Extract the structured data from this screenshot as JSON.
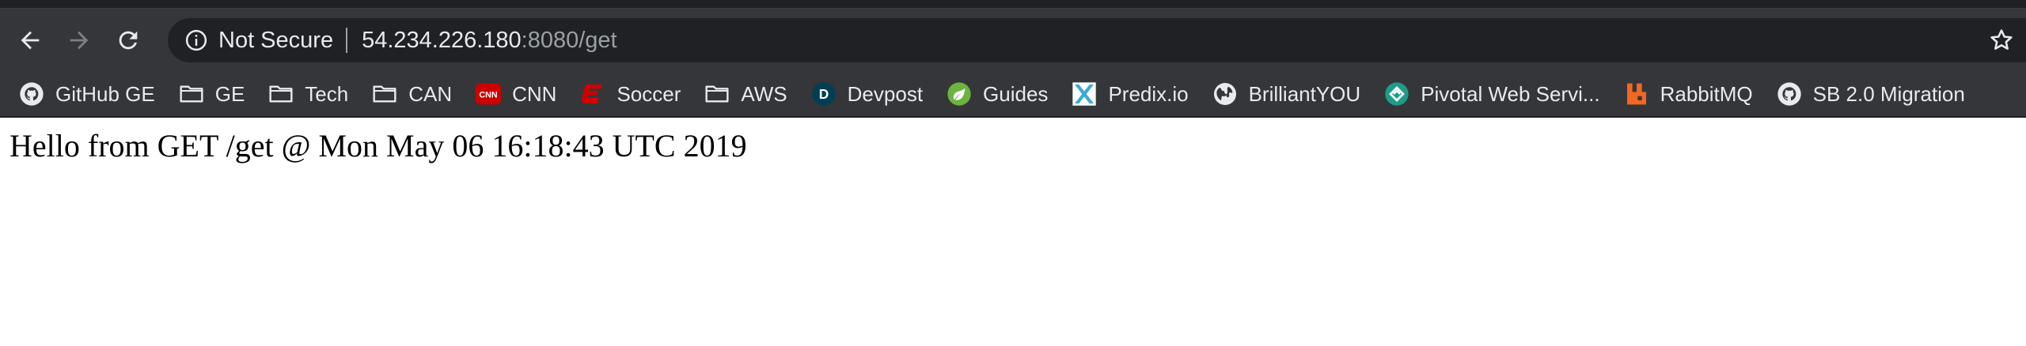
{
  "browser": {
    "security_label": "Not Secure",
    "url_host": "54.234.226.180",
    "url_rest": ":8080/get",
    "icons": [
      "back-arrow-icon",
      "forward-arrow-icon",
      "reload-icon",
      "info-icon",
      "star-icon"
    ]
  },
  "bookmarks": [
    {
      "label": "GitHub GE",
      "icon": "github-icon"
    },
    {
      "label": "GE",
      "icon": "folder-icon"
    },
    {
      "label": "Tech",
      "icon": "folder-icon"
    },
    {
      "label": "CAN",
      "icon": "folder-icon"
    },
    {
      "label": "CNN",
      "icon": "cnn-icon",
      "icon_text": "CNN"
    },
    {
      "label": "Soccer",
      "icon": "espn-icon"
    },
    {
      "label": "AWS",
      "icon": "folder-icon"
    },
    {
      "label": "Devpost",
      "icon": "devpost-icon",
      "icon_text": "D"
    },
    {
      "label": "Guides",
      "icon": "spring-icon"
    },
    {
      "label": "Predix.io",
      "icon": "predix-icon"
    },
    {
      "label": "BrilliantYOU",
      "icon": "globe-icon"
    },
    {
      "label": "Pivotal Web Servi...",
      "icon": "pivotal-icon"
    },
    {
      "label": "RabbitMQ",
      "icon": "rabbitmq-icon"
    },
    {
      "label": "SB 2.0 Migration",
      "icon": "github-icon"
    }
  ],
  "page": {
    "text": "Hello from GET /get @ Mon May 06 16:18:43 UTC 2019"
  },
  "colors": {
    "toolbar_bg": "#35363a",
    "omnibox_bg": "#202124",
    "text_light": "#e8eaed",
    "text_dim": "#9aa0a6",
    "cnn_red": "#cc0000",
    "spring_green": "#6db33f",
    "rabbit_orange": "#f26722",
    "pivotal_teal": "#1e9c8a"
  }
}
